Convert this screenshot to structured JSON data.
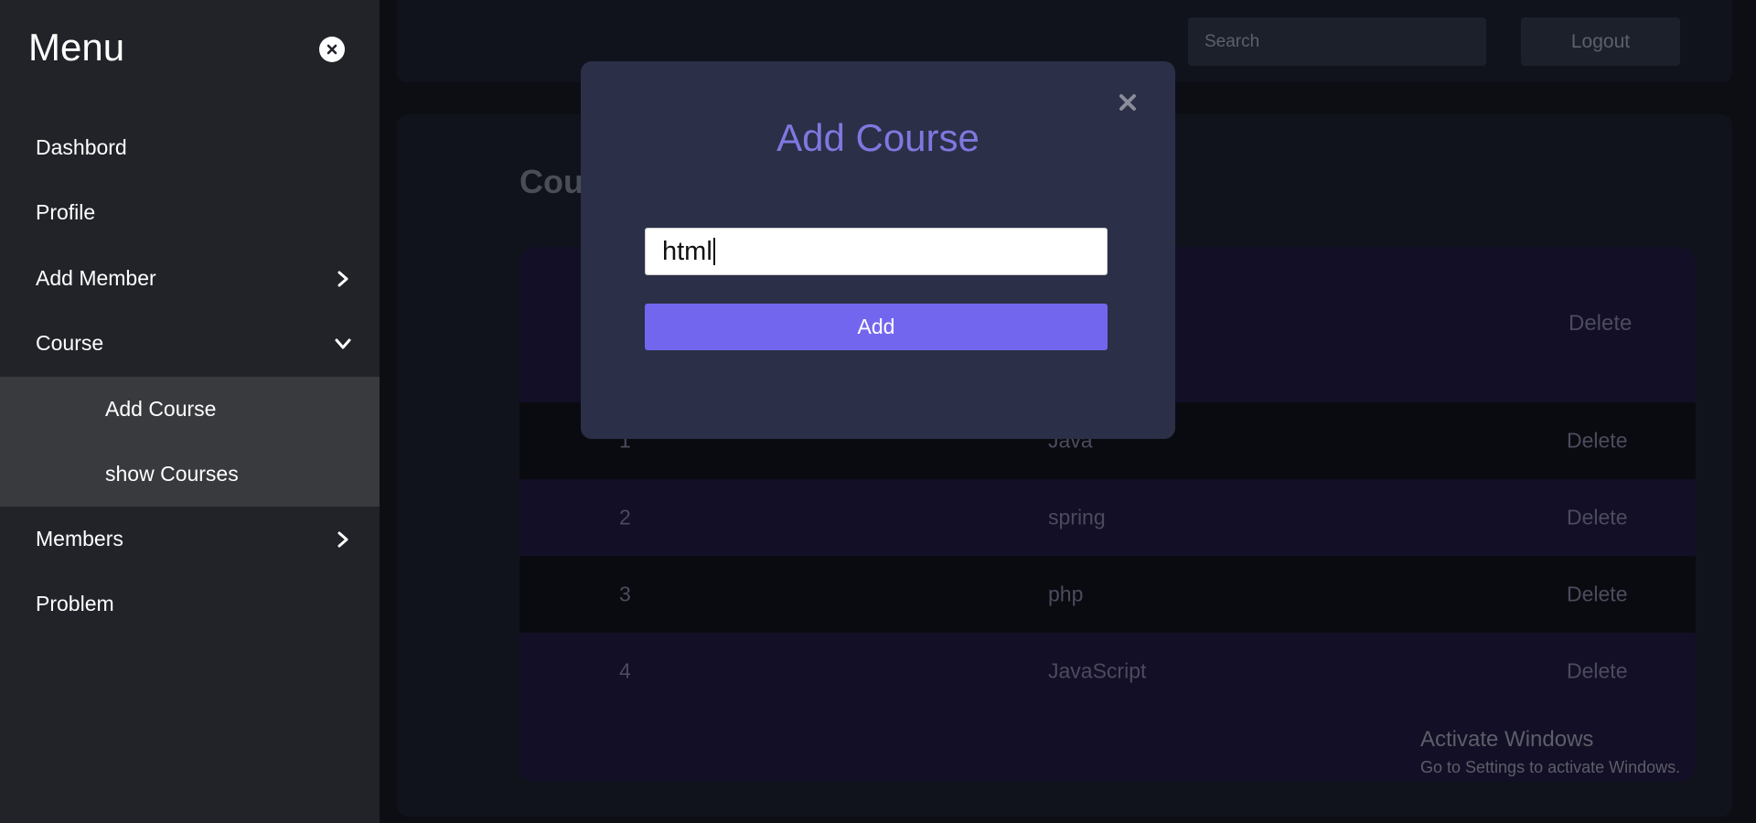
{
  "sidebar": {
    "title": "Menu",
    "items": [
      {
        "label": "Dashbord"
      },
      {
        "label": "Profile"
      },
      {
        "label": "Add Member"
      },
      {
        "label": "Course"
      },
      {
        "label": "Members"
      },
      {
        "label": "Problem"
      }
    ],
    "course_sub": [
      {
        "label": "Add Course"
      },
      {
        "label": "show Courses"
      }
    ]
  },
  "topbar": {
    "search_placeholder": "Search",
    "logout_label": "Logout"
  },
  "main": {
    "heading": "Cou",
    "header_delete": "Delete",
    "rows": [
      {
        "id": "1",
        "name": "Java",
        "action": "Delete"
      },
      {
        "id": "2",
        "name": "spring",
        "action": "Delete"
      },
      {
        "id": "3",
        "name": "php",
        "action": "Delete"
      },
      {
        "id": "4",
        "name": "JavaScript",
        "action": "Delete"
      }
    ]
  },
  "modal": {
    "title": "Add Course",
    "input_value": "html",
    "add_label": "Add"
  },
  "watermark": {
    "title": "Activate Windows",
    "subtitle": "Go to Settings to activate Windows."
  },
  "colors": {
    "sidebar_bg": "#212329",
    "submenu_bg": "#393a3e",
    "modal_bg": "#2b2f47",
    "accent": "#7366ee",
    "modal_title": "#7f78e0"
  }
}
